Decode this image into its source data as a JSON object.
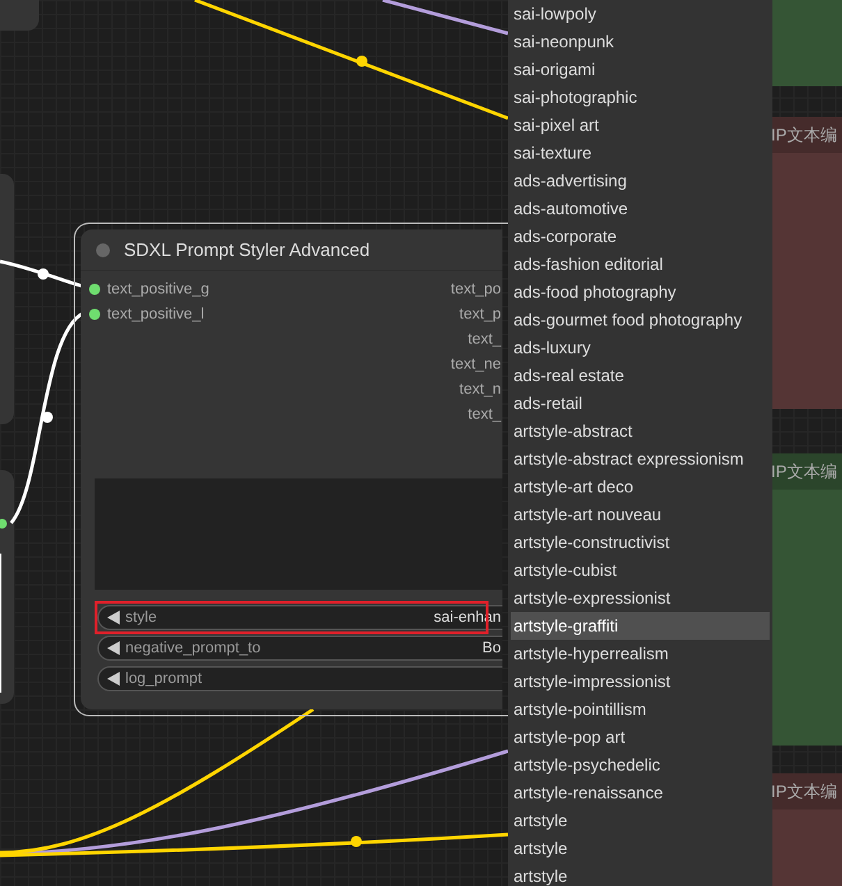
{
  "node": {
    "title": "SDXL Prompt Styler Advanced",
    "inputs": [
      {
        "label": "text_positive_g"
      },
      {
        "label": "text_positive_l"
      }
    ],
    "outputs": [
      {
        "label": "text_po"
      },
      {
        "label": "text_p"
      },
      {
        "label": "text_"
      },
      {
        "label": "text_ne"
      },
      {
        "label": "text_n"
      },
      {
        "label": "text_"
      }
    ],
    "widgets": [
      {
        "label": "style",
        "value": "sai-enhan",
        "highlighted": true
      },
      {
        "label": "negative_prompt_to",
        "value": "Bo",
        "highlighted": false
      },
      {
        "label": "log_prompt",
        "highlighted": false
      }
    ]
  },
  "menu": {
    "items": [
      {
        "label": "sai-lowpoly",
        "selected": false
      },
      {
        "label": "sai-neonpunk",
        "selected": false
      },
      {
        "label": "sai-origami",
        "selected": false
      },
      {
        "label": "sai-photographic",
        "selected": false
      },
      {
        "label": "sai-pixel art",
        "selected": false
      },
      {
        "label": "sai-texture",
        "selected": false
      },
      {
        "label": "ads-advertising",
        "selected": false
      },
      {
        "label": "ads-automotive",
        "selected": false
      },
      {
        "label": "ads-corporate",
        "selected": false
      },
      {
        "label": "ads-fashion editorial",
        "selected": false
      },
      {
        "label": "ads-food photography",
        "selected": false
      },
      {
        "label": "ads-gourmet food photography",
        "selected": false
      },
      {
        "label": "ads-luxury",
        "selected": false
      },
      {
        "label": "ads-real estate",
        "selected": false
      },
      {
        "label": "ads-retail",
        "selected": false
      },
      {
        "label": "artstyle-abstract",
        "selected": false
      },
      {
        "label": "artstyle-abstract expressionism",
        "selected": false
      },
      {
        "label": "artstyle-art deco",
        "selected": false
      },
      {
        "label": "artstyle-art nouveau",
        "selected": false
      },
      {
        "label": "artstyle-constructivist",
        "selected": false
      },
      {
        "label": "artstyle-cubist",
        "selected": false
      },
      {
        "label": "artstyle-expressionist",
        "selected": false
      },
      {
        "label": "artstyle-graffiti",
        "selected": true
      },
      {
        "label": "artstyle-hyperrealism",
        "selected": false
      },
      {
        "label": "artstyle-impressionist",
        "selected": false
      },
      {
        "label": "artstyle-pointillism",
        "selected": false
      },
      {
        "label": "artstyle-pop art",
        "selected": false
      },
      {
        "label": "artstyle-psychedelic",
        "selected": false
      },
      {
        "label": "artstyle-renaissance",
        "selected": false
      },
      {
        "label": "artstyle",
        "selected": false
      },
      {
        "label": "artstyle",
        "selected": false
      },
      {
        "label": "artstyle",
        "selected": false
      }
    ]
  },
  "side_nodes": [
    {
      "title": "IP文本编",
      "color": "#553535"
    },
    {
      "title": "IP文本编",
      "color": "#355535"
    },
    {
      "title": "IP文本编",
      "color": "#553535"
    }
  ]
}
